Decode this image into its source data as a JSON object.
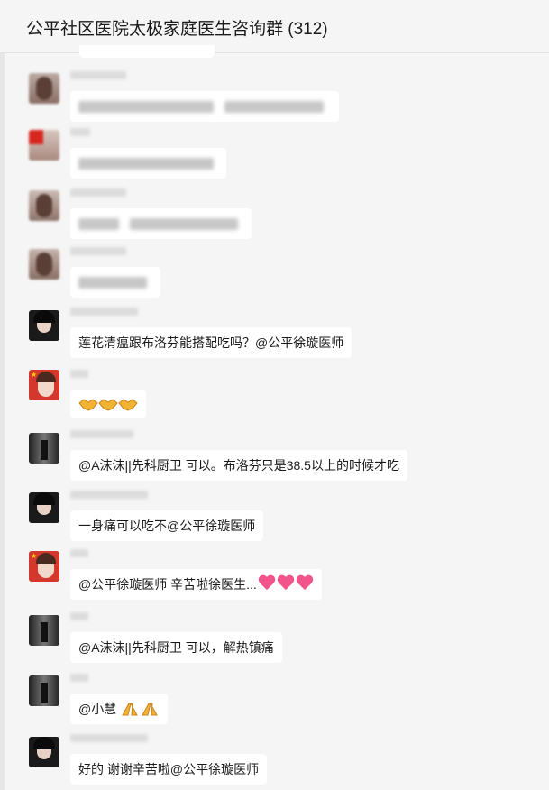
{
  "header": {
    "title": "公平社区医院太极家庭医生咨询群 (312)"
  },
  "colors": {
    "background": "#f5f5f5",
    "bubble": "#ffffff",
    "text": "#1a1a1a",
    "heart": "#f0548a",
    "handshake": "#f2b233"
  },
  "messages": [
    {
      "sender_blurred": true,
      "text_blurred": true
    },
    {
      "sender_blurred": true,
      "text_blurred": true
    },
    {
      "sender_blurred": true,
      "text_blurred": true
    },
    {
      "sender_blurred": true,
      "text_blurred": true
    },
    {
      "sender_blurred": true,
      "text": "莲花清瘟跟布洛芬能搭配吃吗？@公平徐璇医师"
    },
    {
      "sender_blurred": true,
      "text": "",
      "icons": [
        "handshake-icon",
        "handshake-icon",
        "handshake-icon"
      ]
    },
    {
      "sender_blurred": true,
      "text": "@A沫沫||先科厨卫 可以。布洛芬只是38.5以上的时候才吃"
    },
    {
      "sender_blurred": true,
      "text": "一身痛可以吃不@公平徐璇医师"
    },
    {
      "sender_blurred": true,
      "text": "@公平徐璇医师 辛苦啦徐医生...",
      "icons": [
        "heart-icon",
        "heart-icon",
        "heart-icon"
      ]
    },
    {
      "sender_blurred": true,
      "text": "@A沫沫||先科厨卫 可以，解热镇痛"
    },
    {
      "sender_blurred": true,
      "text": "@小慧",
      "icons": [
        "pray-icon",
        "pray-icon"
      ]
    },
    {
      "sender_blurred": true,
      "text": "好的 谢谢辛苦啦@公平徐璇医师"
    }
  ]
}
